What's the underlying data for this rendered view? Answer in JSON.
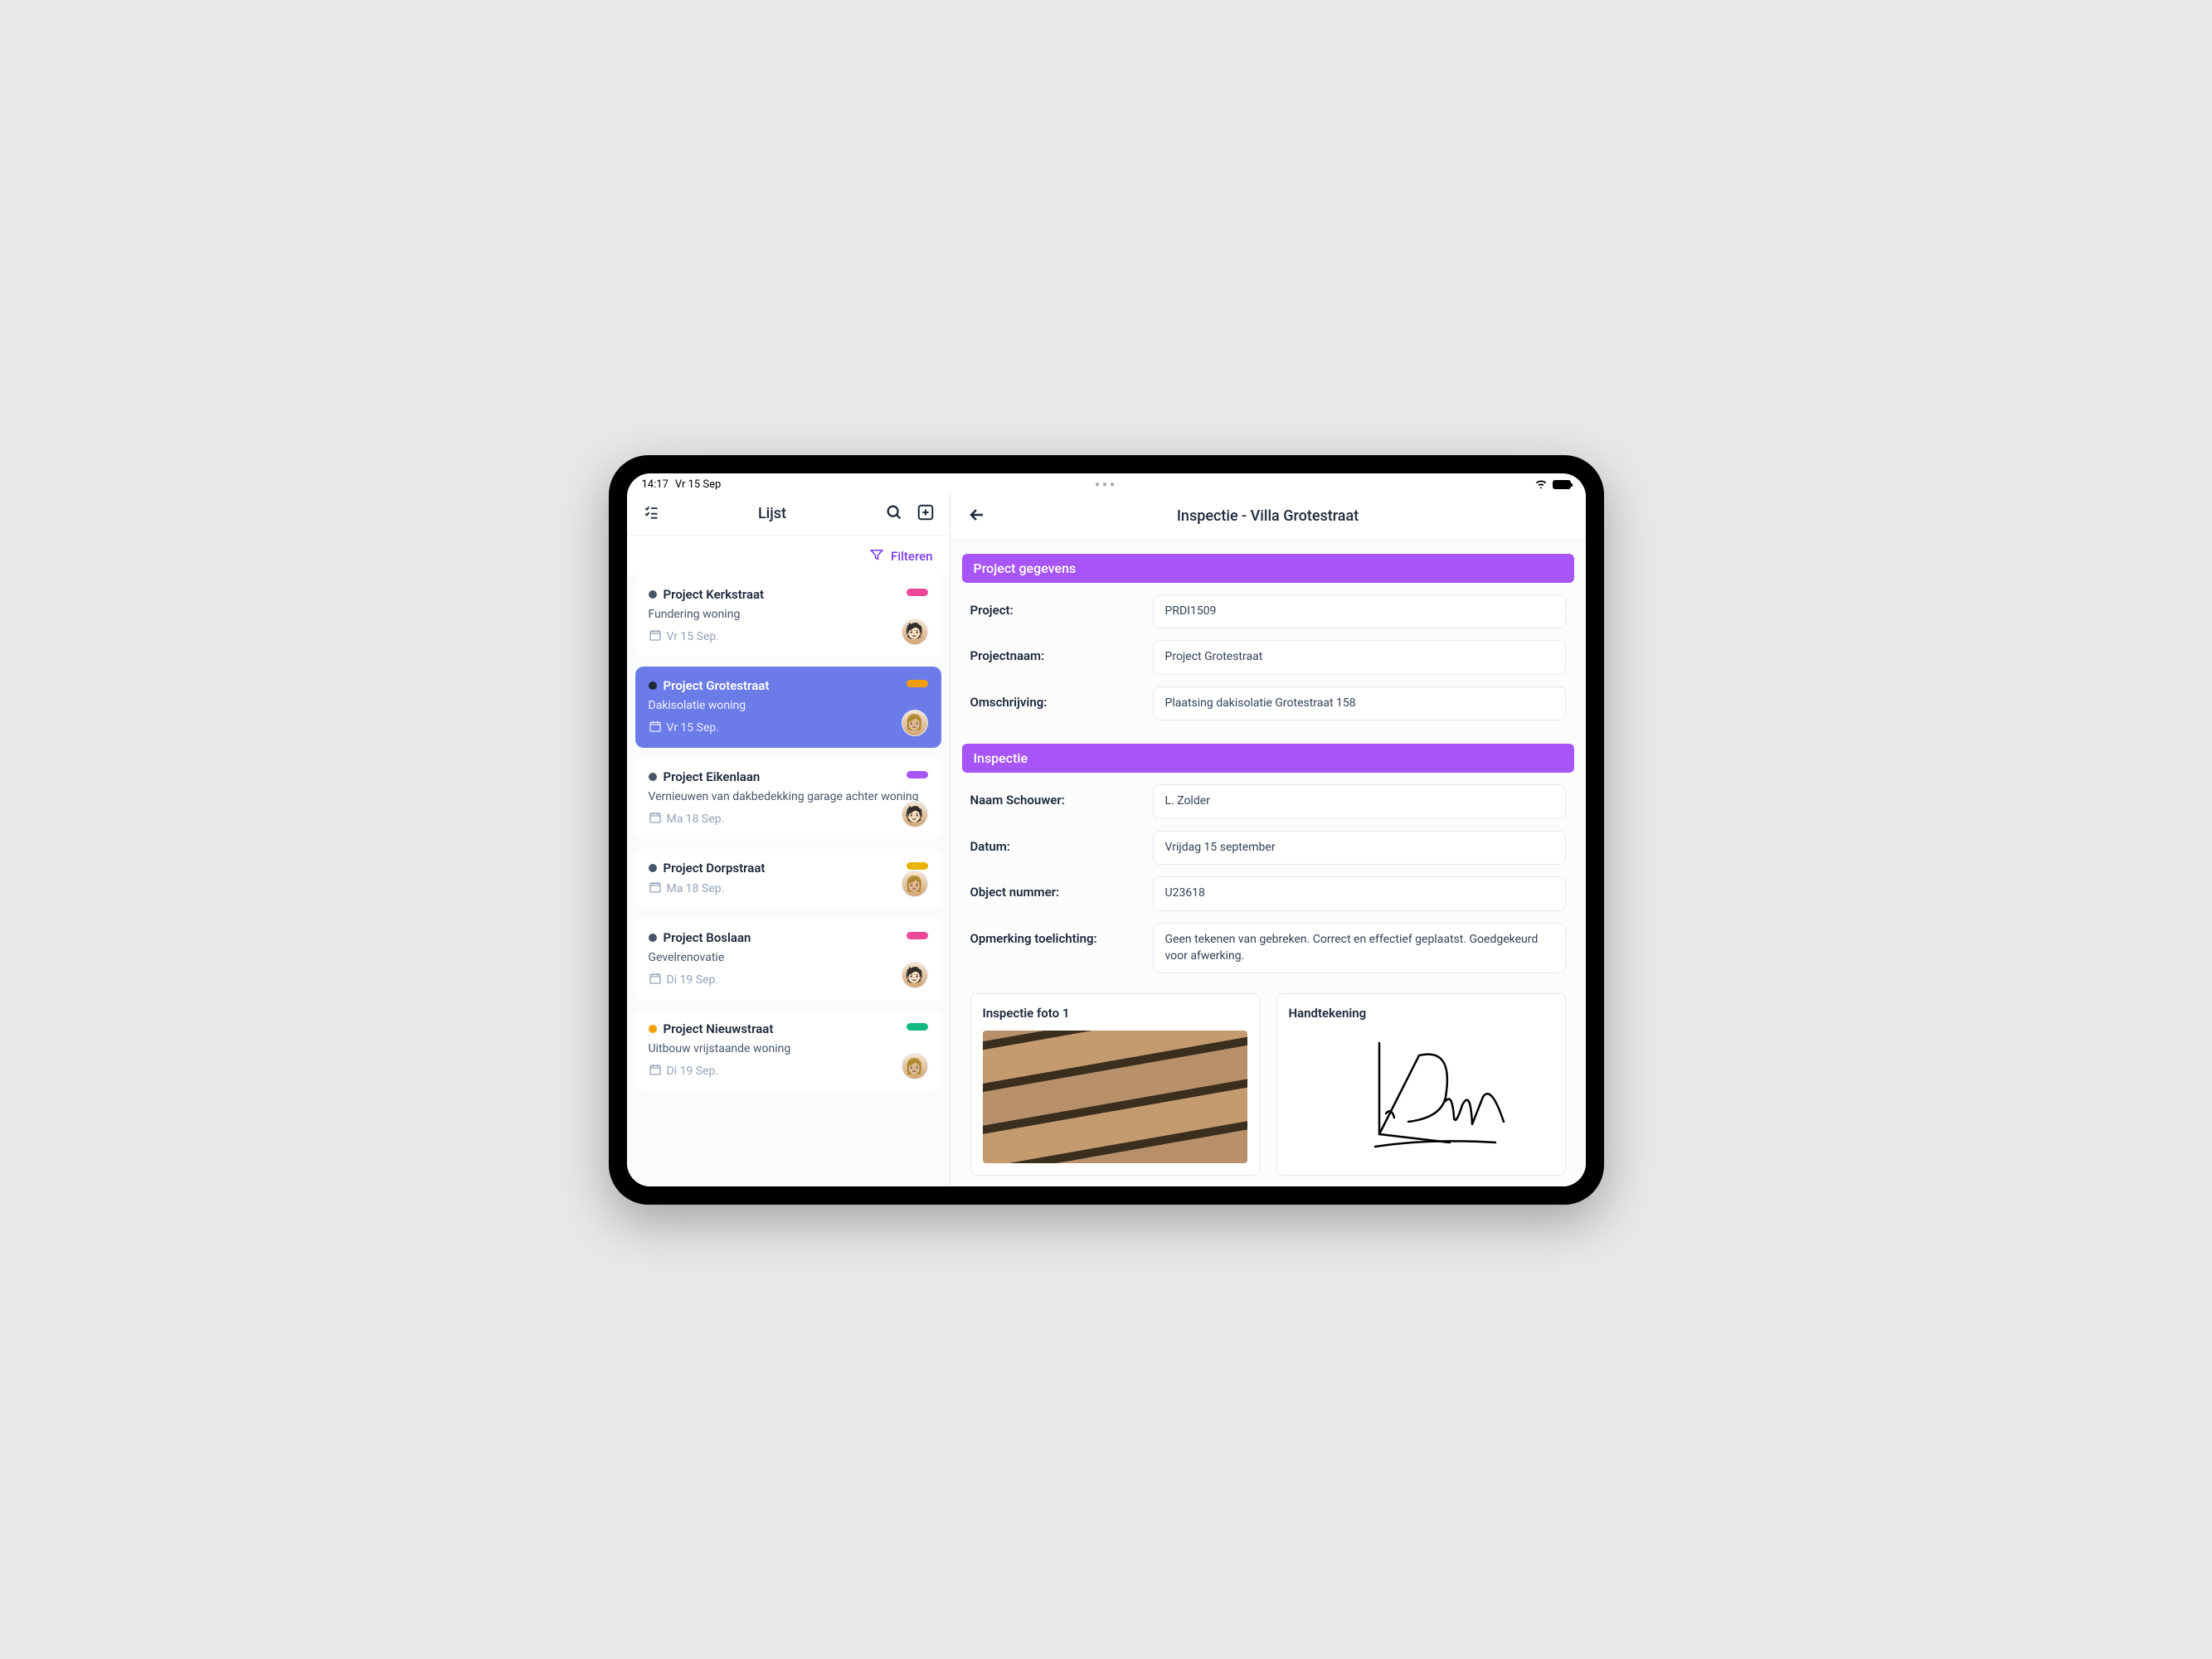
{
  "status": {
    "time": "14:17",
    "date": "Vr 15 Sep"
  },
  "sidebar": {
    "title": "Lijst",
    "filter_label": "Filteren",
    "projects": [
      {
        "title": "Project Kerkstraat",
        "desc": "Fundering woning",
        "date": "Vr 15 Sep.",
        "dot": "#475569",
        "tag": "#ec4899",
        "active": false
      },
      {
        "title": "Project Grotestraat",
        "desc": "Dakisolatie woning",
        "date": "Vr 15 Sep.",
        "dot": "#1e293b",
        "tag": "#f59e0b",
        "active": true
      },
      {
        "title": "Project Eikenlaan",
        "desc": "Vernieuwen van dakbedekking garage achter woning",
        "date": "Ma 18 Sep.",
        "dot": "#475569",
        "tag": "#a855f7",
        "active": false
      },
      {
        "title": "Project Dorpstraat",
        "desc": "",
        "date": "Ma 18 Sep.",
        "dot": "#475569",
        "tag": "#eab308",
        "active": false
      },
      {
        "title": "Project Boslaan",
        "desc": "Gevelrenovatie",
        "date": "Di 19 Sep.",
        "dot": "#475569",
        "tag": "#ec4899",
        "active": false
      },
      {
        "title": "Project Nieuwstraat",
        "desc": "Uitbouw vrijstaande woning",
        "date": "Di 19 Sep.",
        "dot": "#f59e0b",
        "tag": "#10b981",
        "active": false
      }
    ]
  },
  "main": {
    "title": "Inspectie - Villa Grotestraat",
    "sections": {
      "project": {
        "header": "Project gegevens",
        "fields": [
          {
            "label": "Project:",
            "value": "PRDI1509"
          },
          {
            "label": "Projectnaam:",
            "value": "Project Grotestraat"
          },
          {
            "label": "Omschrijving:",
            "value": "Plaatsing dakisolatie Grotestraat 158"
          }
        ]
      },
      "inspectie": {
        "header": "Inspectie",
        "fields": [
          {
            "label": "Naam Schouwer:",
            "value": "L. Zolder"
          },
          {
            "label": "Datum:",
            "value": "Vrijdag 15 september"
          },
          {
            "label": "Object nummer:",
            "value": "U23618"
          },
          {
            "label": "Opmerking toelichting:",
            "value": "Geen tekenen van gebreken. Correct en effectief geplaatst. Goedgekeurd voor afwerking."
          }
        ],
        "photo_label": "Inspectie foto 1",
        "signature_label": "Handtekening"
      }
    }
  }
}
